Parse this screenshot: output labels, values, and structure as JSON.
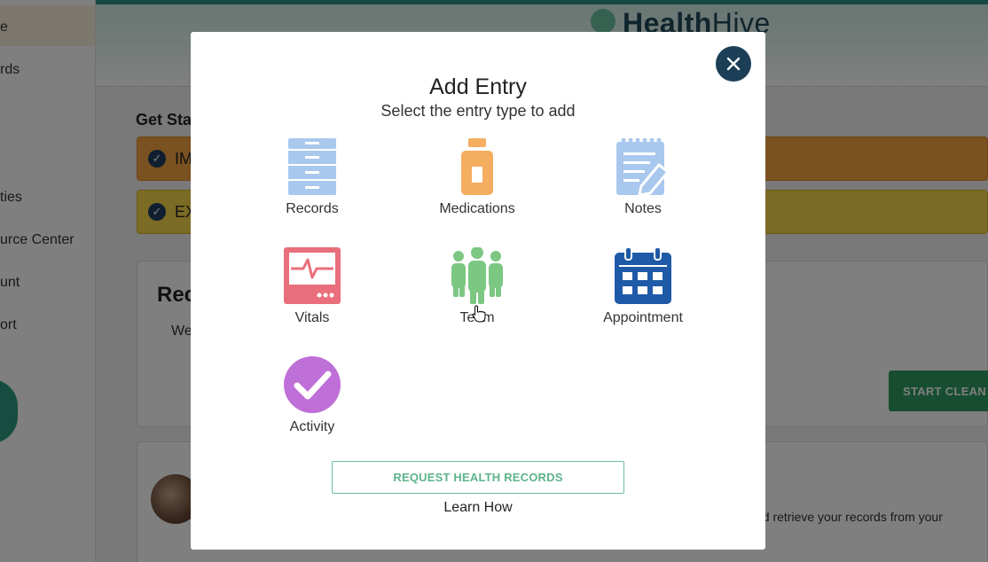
{
  "app": {
    "brand_part1": "Health",
    "brand_part2": "Hive"
  },
  "sidebar": {
    "items": [
      {
        "label": "e"
      },
      {
        "label": "rds"
      },
      {
        "label": "ties"
      },
      {
        "label": "urce Center"
      },
      {
        "label": "unt"
      },
      {
        "label": "ort"
      }
    ]
  },
  "background": {
    "get_started": "Get Sta",
    "bar1_label": "IM",
    "bar2_label": "EX",
    "card_title": "Rec",
    "card_text": "We",
    "start_button": "START CLEAN",
    "retrieve_text": "nd retrieve your records from your"
  },
  "modal": {
    "title": "Add Entry",
    "subtitle": "Select the entry type to add",
    "entries": [
      {
        "label": "Records",
        "icon": "file-cabinet-icon",
        "color": "#a9c8ee"
      },
      {
        "label": "Medications",
        "icon": "pill-bottle-icon",
        "color": "#f5ad60"
      },
      {
        "label": "Notes",
        "icon": "notepad-pencil-icon",
        "color": "#a9c8ee"
      },
      {
        "label": "Vitals",
        "icon": "heart-monitor-icon",
        "color": "#ea6f7c"
      },
      {
        "label": "Team",
        "icon": "team-people-icon",
        "color": "#7cc782"
      },
      {
        "label": "Appointment",
        "icon": "calendar-icon",
        "color": "#1f5aa8"
      },
      {
        "label": "Activity",
        "icon": "check-circle-icon",
        "color": "#bf6fd8"
      }
    ],
    "request_button": "REQUEST HEALTH RECORDS",
    "learn_how": "Learn How",
    "close_icon": "close-icon"
  }
}
